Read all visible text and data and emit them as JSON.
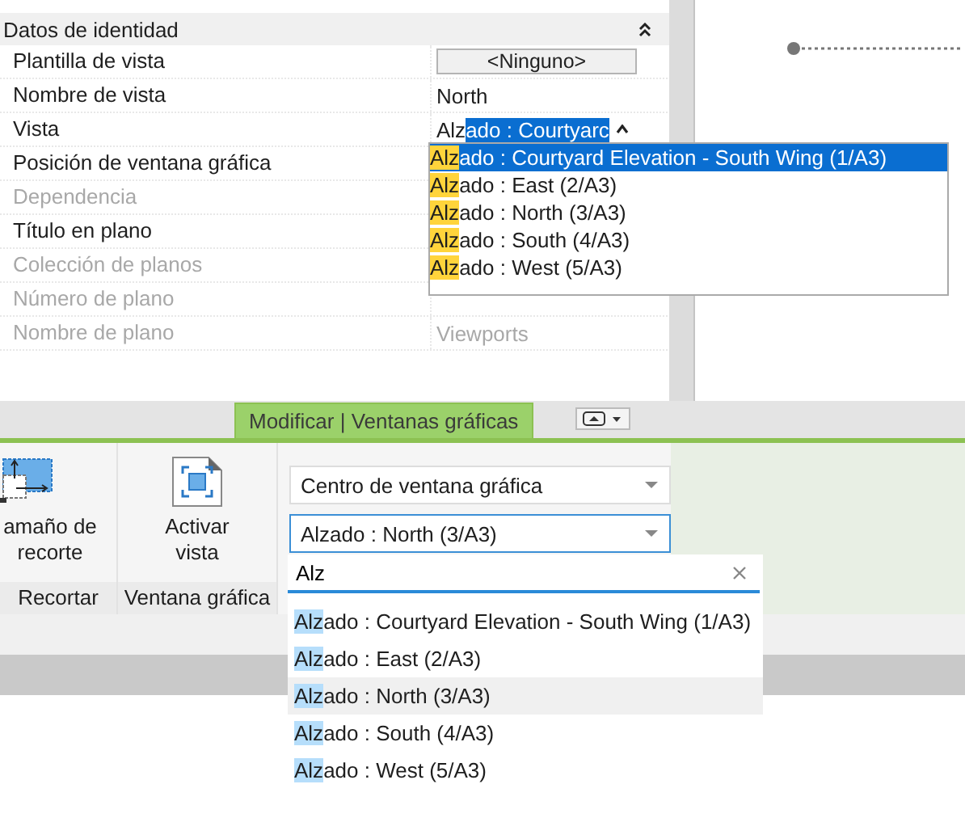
{
  "properties": {
    "group": "Datos de identidad",
    "rows": [
      {
        "label": "Plantilla de vista",
        "kind": "button",
        "value": "<Ninguno>",
        "disabled": false
      },
      {
        "label": "Nombre de vista",
        "kind": "text",
        "value": "North",
        "disabled": false
      },
      {
        "label": "Vista",
        "kind": "combo",
        "typed": "Alz",
        "selection": "ado : Courtyarc",
        "disabled": false
      },
      {
        "label": "Posición de ventana gráfica",
        "kind": "none",
        "disabled": false
      },
      {
        "label": "Dependencia",
        "kind": "none",
        "disabled": true
      },
      {
        "label": "Título en plano",
        "kind": "none",
        "disabled": false
      },
      {
        "label": "Colección de planos",
        "kind": "none",
        "disabled": true
      },
      {
        "label": "Número de plano",
        "kind": "none",
        "disabled": true
      },
      {
        "label": "Nombre de plano",
        "kind": "text",
        "value": "Viewports",
        "disabled": true
      }
    ]
  },
  "view_dropdown": {
    "items": [
      {
        "match": "Alz",
        "rest": "ado : Courtyard Elevation - South Wing (1/A3)",
        "selected": true
      },
      {
        "match": "Alz",
        "rest": "ado : East (2/A3)",
        "selected": false
      },
      {
        "match": "Alz",
        "rest": "ado : North (3/A3)",
        "selected": false
      },
      {
        "match": "Alz",
        "rest": "ado : South (4/A3)",
        "selected": false
      },
      {
        "match": "Alz",
        "rest": "ado : West (5/A3)",
        "selected": false
      }
    ]
  },
  "ribbon": {
    "tabs": [
      {
        "label": "Modificar | Ventanas gráficas",
        "selected": true
      }
    ],
    "panels": [
      {
        "title": "Recortar",
        "tool": "amaño de recorte",
        "kind": "crop"
      },
      {
        "title": "Ventana gráfica",
        "tool": "Activar vista",
        "kind": "activate"
      }
    ],
    "position_combo": "Centro de ventana gráfica",
    "view_combo": "Alzado : North (3/A3)",
    "search": {
      "value": "Alz"
    },
    "items": [
      {
        "match": "Alz",
        "rest": "ado : Courtyard Elevation - South Wing (1/A3)",
        "selected": false
      },
      {
        "match": "Alz",
        "rest": "ado : East (2/A3)",
        "selected": false
      },
      {
        "match": "Alz",
        "rest": "ado : North (3/A3)",
        "selected": true
      },
      {
        "match": "Alz",
        "rest": "ado : South (4/A3)",
        "selected": false
      },
      {
        "match": "Alz",
        "rest": "ado : West (5/A3)",
        "selected": false
      }
    ]
  }
}
